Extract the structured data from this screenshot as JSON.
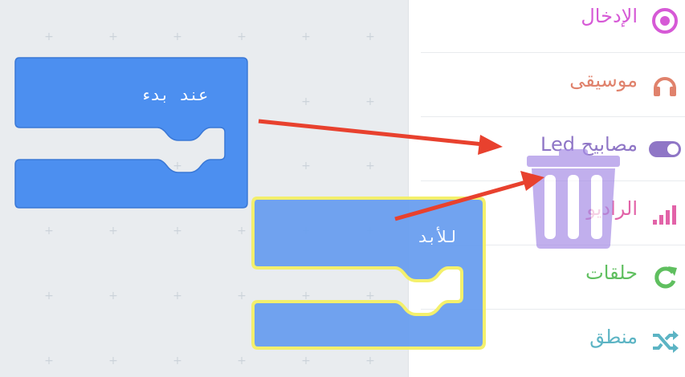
{
  "workspace": {
    "on_start_block": {
      "label": "عند بدء",
      "color": "#4c8ff0"
    },
    "forever_block": {
      "label": "للأبد",
      "color": "#6a9ff0",
      "highlight": "#f4f065"
    }
  },
  "toolbox": {
    "categories": [
      {
        "label": "الإدخال",
        "color": "#d659d6",
        "icon": "target-icon"
      },
      {
        "label": "موسيقى",
        "color": "#e0826c",
        "icon": "headphones-icon"
      },
      {
        "label": "مصابيح Led",
        "color": "#8f76c6",
        "icon": "toggle-icon"
      },
      {
        "label": "الراديو",
        "color": "#e263a8",
        "icon": "signal-bars-icon"
      },
      {
        "label": "حلقات",
        "color": "#5fbf5f",
        "icon": "refresh-icon"
      },
      {
        "label": "منطق",
        "color": "#5cb4c4",
        "icon": "shuffle-icon"
      }
    ]
  },
  "trash": {
    "icon": "trash-icon",
    "color": "#a78ee6"
  },
  "annotations": {
    "arrow_color": "#e8412e"
  }
}
